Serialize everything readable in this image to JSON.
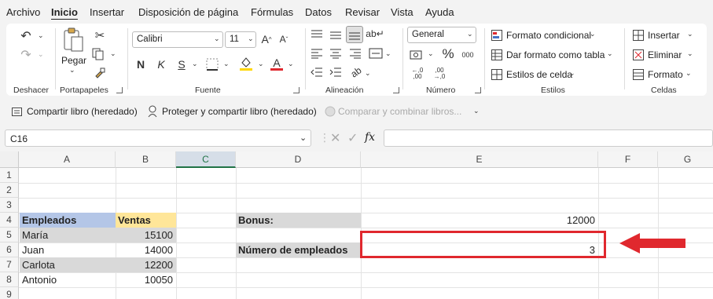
{
  "menu": {
    "items": [
      "Archivo",
      "Inicio",
      "Insertar",
      "Disposición de página",
      "Fórmulas",
      "Datos",
      "Revisar",
      "Vista",
      "Ayuda"
    ]
  },
  "ribbon": {
    "undo_group": "Deshacer",
    "clipboard": {
      "paste": "Pegar",
      "group": "Portapapeles"
    },
    "font": {
      "name": "Calibri",
      "size": "11",
      "bold": "N",
      "italic": "K",
      "underline": "S",
      "group": "Fuente",
      "grow": "A^",
      "shrink": "Aˇ"
    },
    "alignment": {
      "group": "Alineación"
    },
    "number": {
      "format": "General",
      "group": "Número",
      "percent": "%",
      "thousands": "000"
    },
    "styles": {
      "conditional": "Formato condicional",
      "table": "Dar formato como tabla",
      "cell": "Estilos de celda",
      "group": "Estilos"
    },
    "cells": {
      "insert": "Insertar",
      "delete": "Eliminar",
      "format": "Formato",
      "group": "Celdas"
    }
  },
  "qab": {
    "share": "Compartir libro (heredado)",
    "protect": "Proteger y compartir libro (heredado)",
    "merge": "Comparar y combinar libros..."
  },
  "formula_bar": {
    "name_box": "C16",
    "fx": "fx",
    "content": ""
  },
  "columns": [
    "A",
    "B",
    "C",
    "D",
    "E",
    "F",
    "G"
  ],
  "rows": [
    "1",
    "2",
    "3",
    "4",
    "5",
    "6",
    "7",
    "8",
    "9"
  ],
  "cells": {
    "A4": "Empleados",
    "B4": "Ventas",
    "A5": "María",
    "B5": "15100",
    "A6": "Juan",
    "B6": "14000",
    "A7": "Carlota",
    "B7": "12200",
    "A8": "Antonio",
    "B8": "10050",
    "D4": "Bonus:",
    "E4": "12000",
    "D6": "Número de empleados",
    "E6": "3"
  },
  "colors": {
    "header_blue": "#b4c6e7",
    "header_yellow": "#ffe699",
    "gray_fill": "#d9d9d9",
    "highlight_red": "#e0282e",
    "excel_green": "#217346"
  }
}
